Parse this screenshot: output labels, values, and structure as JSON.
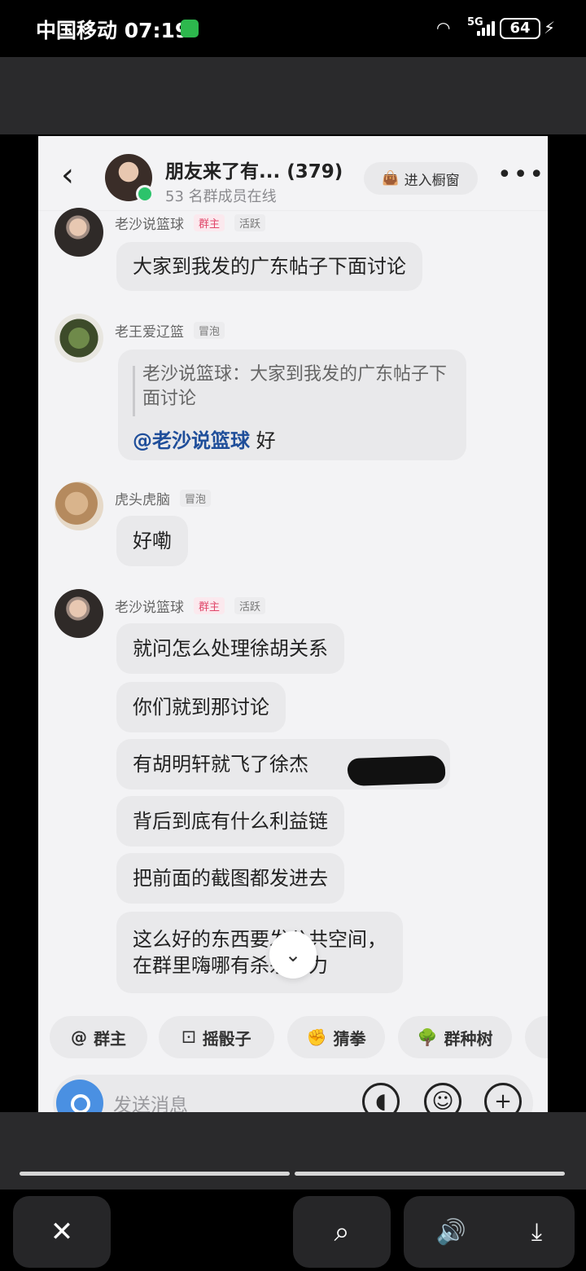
{
  "status_bar": {
    "carrier_time": "中国移动 07:19",
    "signal": "5G",
    "battery": "64"
  },
  "chat": {
    "back_icon": "chevron-left-icon",
    "group_title": "朋友来了有... (379)",
    "online_text": "53 名群成员在线",
    "window_button": "进入橱窗",
    "more_icon": "more-dots-icon"
  },
  "messages": {
    "m1": {
      "name": "老沙说篮球",
      "badge_owner": "群主",
      "badge_active": "活跃",
      "text": "大家到我发的广东帖子下面讨论"
    },
    "m2": {
      "name": "老王爱辽篮",
      "badge": "冒泡",
      "quote": "老沙说篮球：大家到我发的广东帖子下面讨论",
      "mention": "@老沙说篮球",
      "reply": " 好"
    },
    "m3": {
      "name": "虎头虎脑",
      "badge": "冒泡",
      "text": "好嘞"
    },
    "m4": {
      "name": "老沙说篮球",
      "badge_owner": "群主",
      "badge_active": "活跃",
      "lines": [
        "就问怎么处理徐胡关系",
        "你们就到那讨论",
        "有胡明轩就飞了徐杰",
        "背后到底有什么利益链",
        "把前面的截图都发进去"
      ],
      "last_line1": "这么好的东西要发公共空间，",
      "last_line2": "在群里嗨哪有杀杀伤力"
    }
  },
  "chips": {
    "owner": "群主",
    "dice": "摇骰子",
    "rps": "猜拳",
    "tree": "群种树"
  },
  "input": {
    "placeholder": "发送消息"
  },
  "toolbar": {
    "close": "✕",
    "scan": "⌕",
    "sound": "🔊",
    "download": "⤓"
  }
}
